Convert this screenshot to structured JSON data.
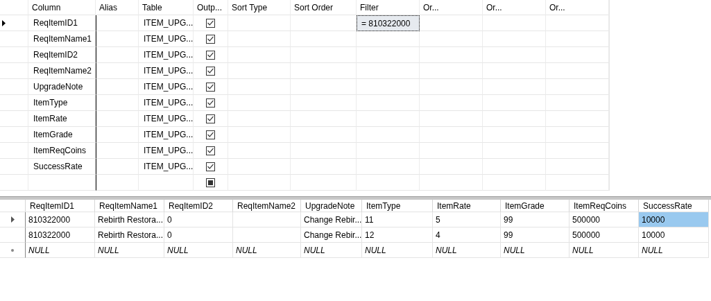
{
  "criteria_grid": {
    "columns": [
      "Column",
      "Alias",
      "Table",
      "Outp...",
      "Sort Type",
      "Sort Order",
      "Filter",
      "Or...",
      "Or...",
      "Or..."
    ],
    "rows": [
      {
        "kind": "data",
        "current": true,
        "column": "ReqItemID1",
        "table": "ITEM_UPG...",
        "output_checked": true,
        "filter": "= 810322000",
        "filter_selected": true
      },
      {
        "kind": "data",
        "current": false,
        "column": "ReqItemName1",
        "table": "ITEM_UPG...",
        "output_checked": true,
        "filter_selected": false
      },
      {
        "kind": "data",
        "current": false,
        "column": "ReqItemID2",
        "table": "ITEM_UPG...",
        "output_checked": true,
        "filter_selected": false
      },
      {
        "kind": "data",
        "current": false,
        "column": "ReqItemName2",
        "table": "ITEM_UPG...",
        "output_checked": true,
        "filter_selected": false
      },
      {
        "kind": "data",
        "current": false,
        "column": "UpgradeNote",
        "table": "ITEM_UPG...",
        "output_checked": true,
        "filter_selected": false
      },
      {
        "kind": "data",
        "current": false,
        "column": "ItemType",
        "table": "ITEM_UPG...",
        "output_checked": true,
        "filter_selected": false
      },
      {
        "kind": "data",
        "current": false,
        "column": "ItemRate",
        "table": "ITEM_UPG...",
        "output_checked": true,
        "filter_selected": false
      },
      {
        "kind": "data",
        "current": false,
        "column": "ItemGrade",
        "table": "ITEM_UPG...",
        "output_checked": true,
        "filter_selected": false
      },
      {
        "kind": "data",
        "current": false,
        "column": "ItemReqCoins",
        "table": "ITEM_UPG...",
        "output_checked": true,
        "filter_selected": false
      },
      {
        "kind": "data",
        "current": false,
        "column": "SuccessRate",
        "table": "ITEM_UPG...",
        "output_checked": true,
        "filter_selected": false
      },
      {
        "kind": "new",
        "current": false,
        "output_checked": true,
        "filter_selected": false
      }
    ]
  },
  "results_grid": {
    "columns": [
      "ReqItemID1",
      "ReqItemName1",
      "ReqItemID2",
      "ReqItemName2",
      "UpgradeNote",
      "ItemType",
      "ItemRate",
      "ItemGrade",
      "ItemReqCoins",
      "SuccessRate"
    ],
    "rows": [
      {
        "kind": "data",
        "current": true,
        "cells": [
          {
            "text": "810322000",
            "selected": false
          },
          {
            "text": "Rebirth Restora...",
            "selected": false
          },
          {
            "text": "0",
            "selected": false
          },
          {
            "selected": false
          },
          {
            "text": "Change Rebir...",
            "selected": false
          },
          {
            "text": "11",
            "selected": false
          },
          {
            "text": "5",
            "selected": false
          },
          {
            "text": "99",
            "selected": false
          },
          {
            "text": "500000",
            "selected": false
          },
          {
            "text": "10000",
            "selected": true
          }
        ]
      },
      {
        "kind": "data",
        "current": false,
        "cells": [
          {
            "text": "810322000",
            "selected": false
          },
          {
            "text": "Rebirth Restora...",
            "selected": false
          },
          {
            "text": "0",
            "selected": false
          },
          {
            "selected": false
          },
          {
            "text": "Change Rebir...",
            "selected": false
          },
          {
            "text": "12",
            "selected": false
          },
          {
            "text": "4",
            "selected": false
          },
          {
            "text": "99",
            "selected": false
          },
          {
            "text": "500000",
            "selected": false
          },
          {
            "text": "10000",
            "selected": false
          }
        ]
      },
      {
        "kind": "new",
        "current": false,
        "cells": [
          {
            "text": "NULL",
            "selected": false
          },
          {
            "text": "NULL",
            "selected": false
          },
          {
            "text": "NULL",
            "selected": false
          },
          {
            "text": "NULL",
            "selected": false
          },
          {
            "text": "NULL",
            "selected": false
          },
          {
            "text": "NULL",
            "selected": false
          },
          {
            "text": "NULL",
            "selected": false
          },
          {
            "text": "NULL",
            "selected": false
          },
          {
            "text": "NULL",
            "selected": false
          },
          {
            "text": "NULL",
            "selected": false
          }
        ]
      }
    ]
  }
}
